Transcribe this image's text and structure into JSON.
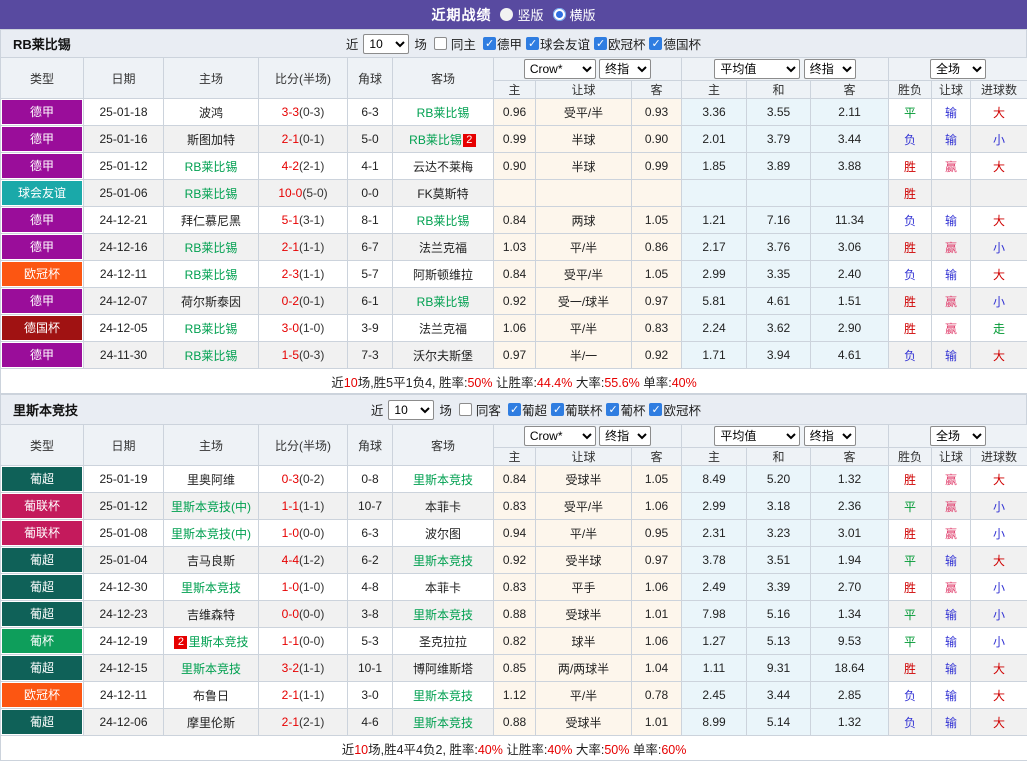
{
  "topbar": {
    "title": "近期战绩",
    "radios": [
      {
        "label": "竖版",
        "checked": false
      },
      {
        "label": "横版",
        "checked": true
      }
    ]
  },
  "table_head": {
    "cols": [
      "类型",
      "日期",
      "主场",
      "比分(半场)",
      "角球",
      "客场"
    ],
    "odds_select1": "Crow*",
    "odds_select2": "终指",
    "avg_select1": "平均值",
    "avg_select2": "终指",
    "full_select": "全场",
    "sub": [
      "主",
      "让球",
      "客",
      "主",
      "和",
      "客",
      "胜负",
      "让球",
      "进球数"
    ]
  },
  "badge_colors": {
    "德甲": "#9a0d9a",
    "球会友谊": "#1aa9a9",
    "欧冠杯": "#fc5612",
    "德国杯": "#a01212",
    "葡超": "#0f6158",
    "葡联杯": "#c41a5c",
    "葡杯": "#0e9e5b"
  },
  "result_colors": {
    "胜": "#cf0000",
    "平": "#009933",
    "负": "#3434d4",
    "赢": "#e0416e",
    "输": "#3434d4",
    "走": "#009933",
    "大": "#cf0000",
    "小": "#3434d4"
  },
  "sections": [
    {
      "team": "RB莱比锡",
      "filter": {
        "near_label": "近",
        "count": "10",
        "unit_label": "场",
        "same_label": "同主",
        "leagues": [
          "德甲",
          "球会友谊",
          "欧冠杯",
          "德国杯"
        ]
      },
      "rows": [
        {
          "type": "德甲",
          "date": "25-01-18",
          "home": "波鸿",
          "home_focus": false,
          "score": "3-3",
          "half": "(0-3)",
          "corner": "6-3",
          "away": "RB莱比锡",
          "away_focus": true,
          "odds": [
            "0.96",
            "受平/半",
            "0.93"
          ],
          "avg": [
            "3.36",
            "3.55",
            "2.11"
          ],
          "results": [
            "平",
            "输",
            "大"
          ]
        },
        {
          "type": "德甲",
          "date": "25-01-16",
          "home": "斯图加特",
          "home_focus": false,
          "score": "2-1",
          "half": "(0-1)",
          "corner": "5-0",
          "away": "RB莱比锡",
          "away_focus": true,
          "away_badge": {
            "text": "2",
            "pos": "after"
          },
          "odds": [
            "0.99",
            "半球",
            "0.90"
          ],
          "avg": [
            "2.01",
            "3.79",
            "3.44"
          ],
          "results": [
            "负",
            "输",
            "小"
          ]
        },
        {
          "type": "德甲",
          "date": "25-01-12",
          "home": "RB莱比锡",
          "home_focus": true,
          "score": "4-2",
          "half": "(2-1)",
          "corner": "4-1",
          "away": "云达不莱梅",
          "away_focus": false,
          "odds": [
            "0.90",
            "半球",
            "0.99"
          ],
          "avg": [
            "1.85",
            "3.89",
            "3.88"
          ],
          "results": [
            "胜",
            "赢",
            "大"
          ]
        },
        {
          "type": "球会友谊",
          "date": "25-01-06",
          "home": "RB莱比锡",
          "home_focus": true,
          "score": "10-0",
          "half": "(5-0)",
          "corner": "0-0",
          "away": "FK莫斯特",
          "away_focus": false,
          "odds": [
            "",
            "",
            ""
          ],
          "avg": [
            "",
            "",
            ""
          ],
          "results": [
            "胜",
            "",
            ""
          ]
        },
        {
          "type": "德甲",
          "date": "24-12-21",
          "home": "拜仁慕尼黑",
          "home_focus": false,
          "score": "5-1",
          "half": "(3-1)",
          "corner": "8-1",
          "away": "RB莱比锡",
          "away_focus": true,
          "odds": [
            "0.84",
            "两球",
            "1.05"
          ],
          "avg": [
            "1.21",
            "7.16",
            "11.34"
          ],
          "results": [
            "负",
            "输",
            "大"
          ]
        },
        {
          "type": "德甲",
          "date": "24-12-16",
          "home": "RB莱比锡",
          "home_focus": true,
          "score": "2-1",
          "half": "(1-1)",
          "corner": "6-7",
          "away": "法兰克福",
          "away_focus": false,
          "odds": [
            "1.03",
            "平/半",
            "0.86"
          ],
          "avg": [
            "2.17",
            "3.76",
            "3.06"
          ],
          "results": [
            "胜",
            "赢",
            "小"
          ]
        },
        {
          "type": "欧冠杯",
          "date": "24-12-11",
          "home": "RB莱比锡",
          "home_focus": true,
          "score": "2-3",
          "half": "(1-1)",
          "corner": "5-7",
          "away": "阿斯顿维拉",
          "away_focus": false,
          "odds": [
            "0.84",
            "受平/半",
            "1.05"
          ],
          "avg": [
            "2.99",
            "3.35",
            "2.40"
          ],
          "results": [
            "负",
            "输",
            "大"
          ]
        },
        {
          "type": "德甲",
          "date": "24-12-07",
          "home": "荷尔斯泰因",
          "home_focus": false,
          "score": "0-2",
          "half": "(0-1)",
          "corner": "6-1",
          "away": "RB莱比锡",
          "away_focus": true,
          "odds": [
            "0.92",
            "受一/球半",
            "0.97"
          ],
          "avg": [
            "5.81",
            "4.61",
            "1.51"
          ],
          "results": [
            "胜",
            "赢",
            "小"
          ]
        },
        {
          "type": "德国杯",
          "date": "24-12-05",
          "home": "RB莱比锡",
          "home_focus": true,
          "score": "3-0",
          "half": "(1-0)",
          "corner": "3-9",
          "away": "法兰克福",
          "away_focus": false,
          "odds": [
            "1.06",
            "平/半",
            "0.83"
          ],
          "avg": [
            "2.24",
            "3.62",
            "2.90"
          ],
          "results": [
            "胜",
            "赢",
            "走"
          ]
        },
        {
          "type": "德甲",
          "date": "24-11-30",
          "home": "RB莱比锡",
          "home_focus": true,
          "score": "1-5",
          "half": "(0-3)",
          "corner": "7-3",
          "away": "沃尔夫斯堡",
          "away_focus": false,
          "odds": [
            "0.97",
            "半/一",
            "0.92"
          ],
          "avg": [
            "1.71",
            "3.94",
            "4.61"
          ],
          "results": [
            "负",
            "输",
            "大"
          ]
        }
      ],
      "summary": [
        {
          "t": "近",
          "red": false
        },
        {
          "t": "10",
          "red": true
        },
        {
          "t": "场,胜5平1负4, 胜率:",
          "red": false
        },
        {
          "t": "50%",
          "red": true
        },
        {
          "t": " 让胜率:",
          "red": false
        },
        {
          "t": "44.4%",
          "red": true
        },
        {
          "t": " 大率:",
          "red": false
        },
        {
          "t": "55.6%",
          "red": true
        },
        {
          "t": " 单率:",
          "red": false
        },
        {
          "t": "40%",
          "red": true
        }
      ]
    },
    {
      "team": "里斯本竞技",
      "filter": {
        "near_label": "近",
        "count": "10",
        "unit_label": "场",
        "same_label": "同客",
        "leagues": [
          "葡超",
          "葡联杯",
          "葡杯",
          "欧冠杯"
        ]
      },
      "rows": [
        {
          "type": "葡超",
          "date": "25-01-19",
          "home": "里奥阿维",
          "home_focus": false,
          "score": "0-3",
          "half": "(0-2)",
          "corner": "0-8",
          "away": "里斯本竞技",
          "away_focus": true,
          "odds": [
            "0.84",
            "受球半",
            "1.05"
          ],
          "avg": [
            "8.49",
            "5.20",
            "1.32"
          ],
          "results": [
            "胜",
            "赢",
            "大"
          ]
        },
        {
          "type": "葡联杯",
          "date": "25-01-12",
          "home": "里斯本竞技(中)",
          "home_focus": true,
          "score": "1-1",
          "half": "(1-1)",
          "corner": "10-7",
          "away": "本菲卡",
          "away_focus": false,
          "odds": [
            "0.83",
            "受平/半",
            "1.06"
          ],
          "avg": [
            "2.99",
            "3.18",
            "2.36"
          ],
          "results": [
            "平",
            "赢",
            "小"
          ]
        },
        {
          "type": "葡联杯",
          "date": "25-01-08",
          "home": "里斯本竞技(中)",
          "home_focus": true,
          "score": "1-0",
          "half": "(0-0)",
          "corner": "6-3",
          "away": "波尔图",
          "away_focus": false,
          "odds": [
            "0.94",
            "平/半",
            "0.95"
          ],
          "avg": [
            "2.31",
            "3.23",
            "3.01"
          ],
          "results": [
            "胜",
            "赢",
            "小"
          ]
        },
        {
          "type": "葡超",
          "date": "25-01-04",
          "home": "吉马良斯",
          "home_focus": false,
          "score": "4-4",
          "half": "(1-2)",
          "corner": "6-2",
          "away": "里斯本竞技",
          "away_focus": true,
          "odds": [
            "0.92",
            "受半球",
            "0.97"
          ],
          "avg": [
            "3.78",
            "3.51",
            "1.94"
          ],
          "results": [
            "平",
            "输",
            "大"
          ]
        },
        {
          "type": "葡超",
          "date": "24-12-30",
          "home": "里斯本竞技",
          "home_focus": true,
          "score": "1-0",
          "half": "(1-0)",
          "corner": "4-8",
          "away": "本菲卡",
          "away_focus": false,
          "odds": [
            "0.83",
            "平手",
            "1.06"
          ],
          "avg": [
            "2.49",
            "3.39",
            "2.70"
          ],
          "results": [
            "胜",
            "赢",
            "小"
          ]
        },
        {
          "type": "葡超",
          "date": "24-12-23",
          "home": "吉维森特",
          "home_focus": false,
          "score": "0-0",
          "half": "(0-0)",
          "corner": "3-8",
          "away": "里斯本竞技",
          "away_focus": true,
          "odds": [
            "0.88",
            "受球半",
            "1.01"
          ],
          "avg": [
            "7.98",
            "5.16",
            "1.34"
          ],
          "results": [
            "平",
            "输",
            "小"
          ]
        },
        {
          "type": "葡杯",
          "date": "24-12-19",
          "home": "里斯本竞技",
          "home_focus": true,
          "home_badge": {
            "text": "2",
            "pos": "before"
          },
          "score": "1-1",
          "half": "(0-0)",
          "corner": "5-3",
          "away": "圣克拉拉",
          "away_focus": false,
          "odds": [
            "0.82",
            "球半",
            "1.06"
          ],
          "avg": [
            "1.27",
            "5.13",
            "9.53"
          ],
          "results": [
            "平",
            "输",
            "小"
          ]
        },
        {
          "type": "葡超",
          "date": "24-12-15",
          "home": "里斯本竞技",
          "home_focus": true,
          "score": "3-2",
          "half": "(1-1)",
          "corner": "10-1",
          "away": "博阿维斯塔",
          "away_focus": false,
          "odds": [
            "0.85",
            "两/两球半",
            "1.04"
          ],
          "avg": [
            "1.11",
            "9.31",
            "18.64"
          ],
          "results": [
            "胜",
            "输",
            "大"
          ]
        },
        {
          "type": "欧冠杯",
          "date": "24-12-11",
          "home": "布鲁日",
          "home_focus": false,
          "score": "2-1",
          "half": "(1-1)",
          "corner": "3-0",
          "away": "里斯本竞技",
          "away_focus": true,
          "odds": [
            "1.12",
            "平/半",
            "0.78"
          ],
          "avg": [
            "2.45",
            "3.44",
            "2.85"
          ],
          "results": [
            "负",
            "输",
            "大"
          ]
        },
        {
          "type": "葡超",
          "date": "24-12-06",
          "home": "摩里伦斯",
          "home_focus": false,
          "score": "2-1",
          "half": "(2-1)",
          "corner": "4-6",
          "away": "里斯本竞技",
          "away_focus": true,
          "odds": [
            "0.88",
            "受球半",
            "1.01"
          ],
          "avg": [
            "8.99",
            "5.14",
            "1.32"
          ],
          "results": [
            "负",
            "输",
            "大"
          ]
        }
      ],
      "summary": [
        {
          "t": "近",
          "red": false
        },
        {
          "t": "10",
          "red": true
        },
        {
          "t": "场,胜4平4负2, 胜率:",
          "red": false
        },
        {
          "t": "40%",
          "red": true
        },
        {
          "t": " 让胜率:",
          "red": false
        },
        {
          "t": "40%",
          "red": true
        },
        {
          "t": " 大率:",
          "red": false
        },
        {
          "t": "50%",
          "red": true
        },
        {
          "t": " 单率:",
          "red": false
        },
        {
          "t": "60%",
          "red": true
        }
      ]
    }
  ]
}
